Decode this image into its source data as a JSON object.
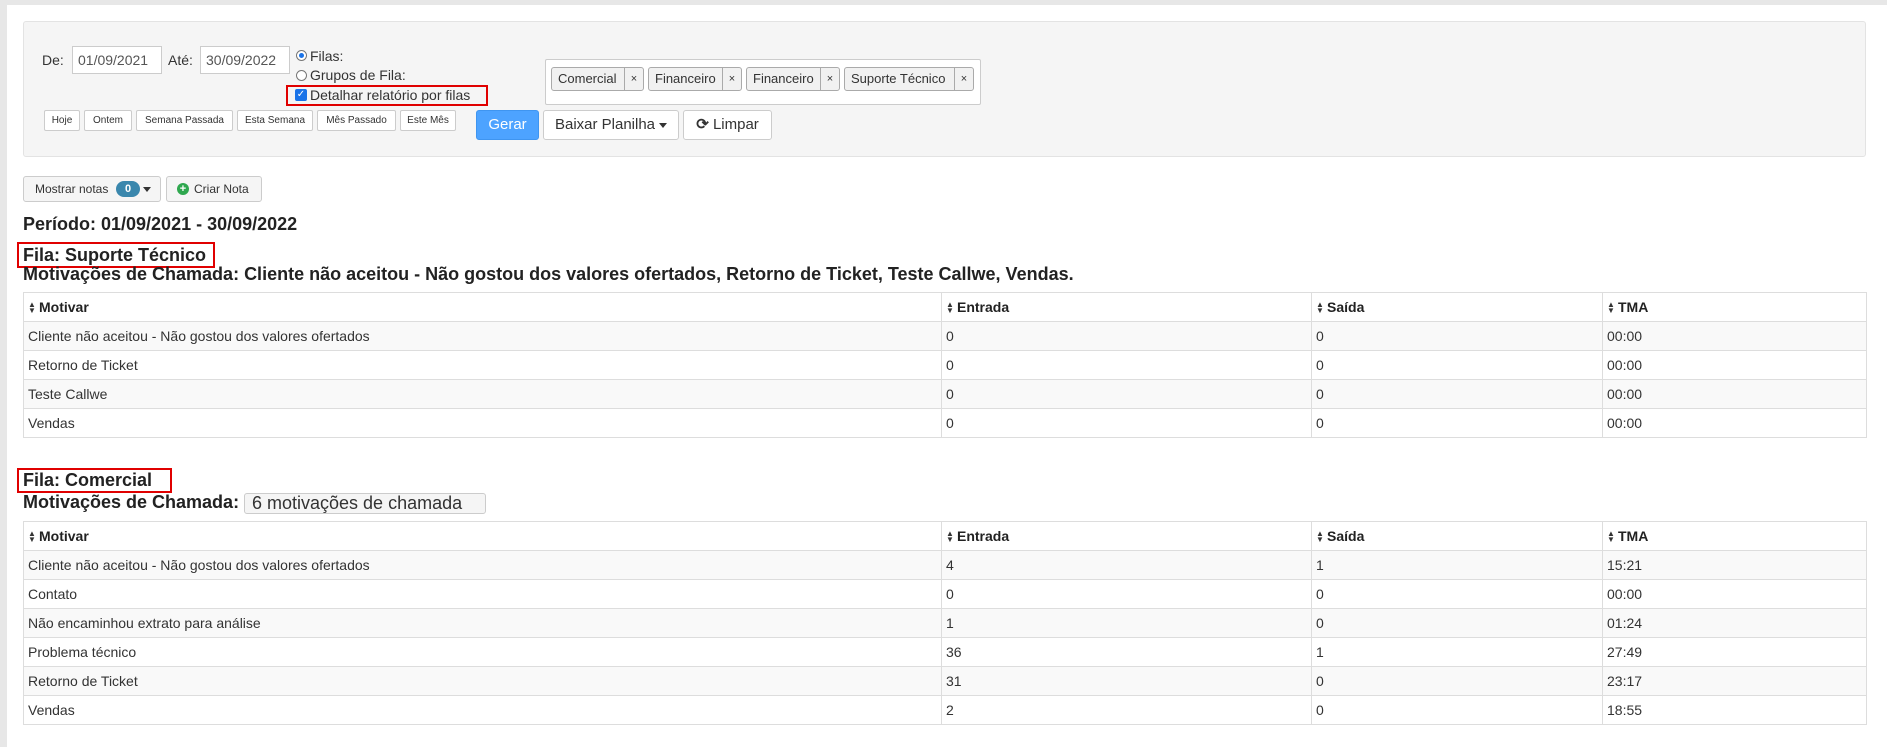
{
  "filters": {
    "from_label": "De:",
    "from_value": "01/09/2021",
    "to_label": "Até:",
    "to_value": "30/09/2022",
    "radio_filas": "Filas:",
    "radio_grupos": "Grupos de Fila:",
    "detail_checkbox": "Detalhar relatório por filas",
    "queue_tags": [
      "Comercial",
      "Financeiro",
      "Financeiro",
      "Suporte Técnico"
    ],
    "tag_remove": "×",
    "quick_buttons": [
      "Hoje",
      "Ontem",
      "Semana Passada",
      "Esta Semana",
      "Mês Passado",
      "Este Mês"
    ],
    "gerar": "Gerar",
    "baixar": "Baixar Planilha",
    "limpar": "Limpar"
  },
  "notes": {
    "show_label": "Mostrar notas",
    "count": "0",
    "create_label": "Criar Nota"
  },
  "period": "Período: 01/09/2021 - 30/09/2022",
  "sections": [
    {
      "fila": "Fila: Suporte Técnico",
      "motivations": "Motivações de Chamada: Cliente não aceitou - Não gostou dos valores ofertados, Retorno de Ticket, Teste Callwe, Vendas.",
      "columns": [
        "Motivar",
        "Entrada",
        "Saída",
        "TMA"
      ],
      "rows": [
        [
          "Cliente não aceitou - Não gostou dos valores ofertados",
          "0",
          "0",
          "00:00"
        ],
        [
          "Retorno de Ticket",
          "0",
          "0",
          "00:00"
        ],
        [
          "Teste Callwe",
          "0",
          "0",
          "00:00"
        ],
        [
          "Vendas",
          "0",
          "0",
          "00:00"
        ]
      ]
    },
    {
      "fila": "Fila: Comercial",
      "motivations_label": "Motivações de Chamada:",
      "motivations_dropdown": "6 motivações de chamada",
      "columns": [
        "Motivar",
        "Entrada",
        "Saída",
        "TMA"
      ],
      "rows": [
        [
          "Cliente não aceitou - Não gostou dos valores ofertados",
          "4",
          "1",
          "15:21"
        ],
        [
          "Contato",
          "0",
          "0",
          "00:00"
        ],
        [
          "Não encaminhou extrato para análise",
          "1",
          "0",
          "01:24"
        ],
        [
          "Problema técnico",
          "36",
          "1",
          "27:49"
        ],
        [
          "Retorno de Ticket",
          "31",
          "0",
          "23:17"
        ],
        [
          "Vendas",
          "2",
          "0",
          "18:55"
        ]
      ]
    }
  ],
  "colors": {
    "primary": "#4da3ff",
    "highlight": "#e00000",
    "badge": "#3a87ad"
  }
}
